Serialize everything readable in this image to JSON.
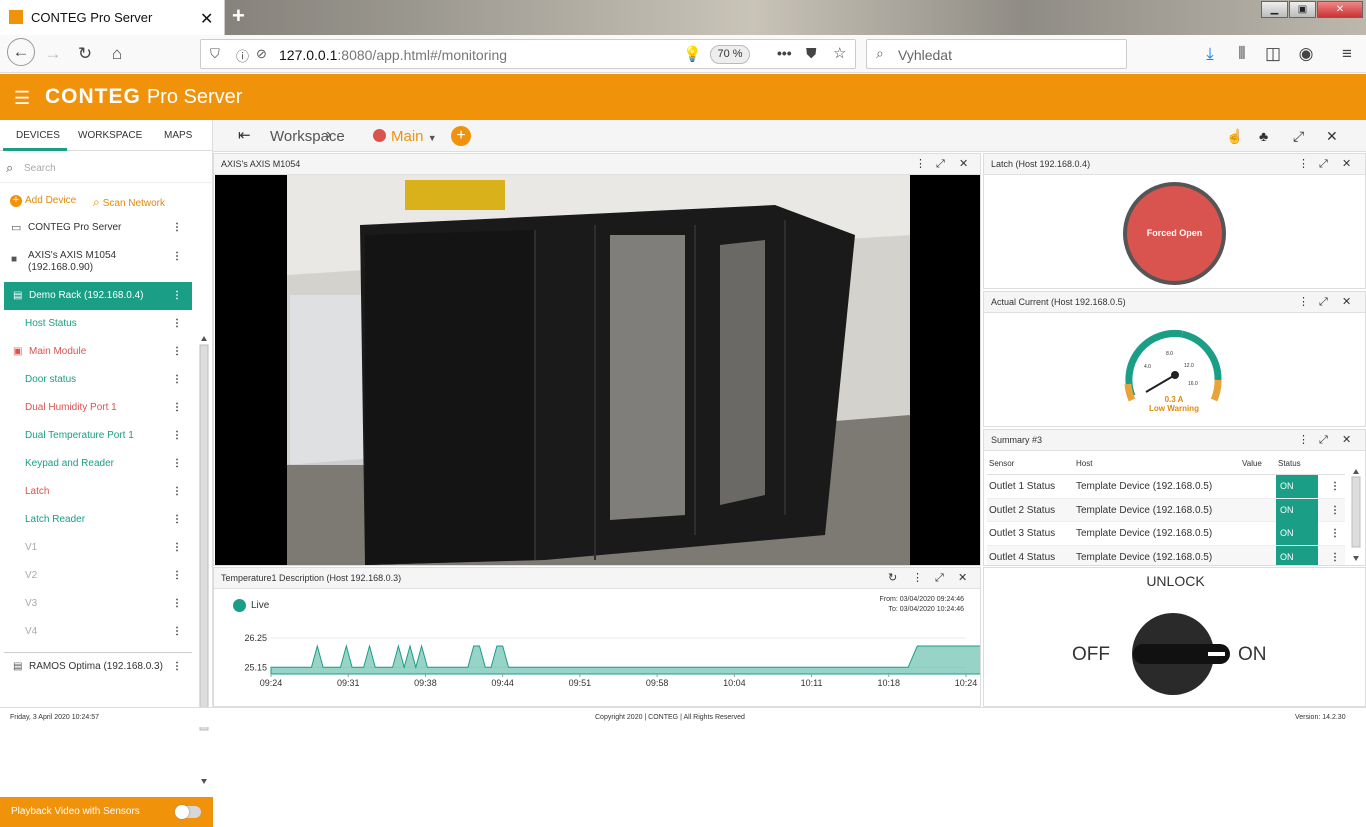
{
  "browser": {
    "tab_title": "CONTEG Pro Server",
    "url_host": "127.0.0.1",
    "url_rest": ":8080/app.html#/monitoring",
    "zoom": "70 %",
    "search_placeholder": "Vyhledat"
  },
  "app": {
    "logo": "CONTEG",
    "logo_sub": "Pro Server",
    "brand_color": "#f0920a",
    "accent_color": "#1a9e86"
  },
  "sidebar": {
    "tabs": [
      "DEVICES",
      "WORKSPACE",
      "MAPS"
    ],
    "search_placeholder": "Search",
    "add_device": "Add Device",
    "scan_network": "Scan Network",
    "items": [
      {
        "label": "CONTEG Pro Server",
        "icon": "monitor-icon"
      },
      {
        "label": "AXIS's AXIS M1054",
        "label2": "(192.168.0.90)",
        "icon": "camera-icon"
      },
      {
        "label": "Demo Rack (192.168.0.4)",
        "icon": "rack-icon"
      },
      {
        "label": "Host Status"
      },
      {
        "label": "Main Module",
        "icon": "module-icon"
      },
      {
        "label": "Door status"
      },
      {
        "label": "Dual Humidity Port 1"
      },
      {
        "label": "Dual Temperature Port 1"
      },
      {
        "label": "Keypad and Reader"
      },
      {
        "label": "Latch"
      },
      {
        "label": "Latch Reader"
      },
      {
        "label": "V1"
      },
      {
        "label": "V2"
      },
      {
        "label": "V3"
      },
      {
        "label": "V4"
      },
      {
        "label": "RAMOS Optima (192.168.0.3)",
        "icon": "rack-icon"
      }
    ],
    "playback": "Playback Video with Sensors"
  },
  "workspace": {
    "label": "Workspace",
    "current": "Main"
  },
  "panels": {
    "camera_title": "AXIS's AXIS M1054",
    "latch_title": "Latch (Host 192.168.0.4)",
    "latch_state": "Forced Open",
    "current_title": "Actual Current (Host 192.168.0.5)",
    "gauge_value": "0.3 A",
    "gauge_status": "Low Warning",
    "summary_title": "Summary #3",
    "summary_headers": [
      "Sensor",
      "Host",
      "Value",
      "Status"
    ],
    "summary_rows": [
      {
        "sensor": "Outlet 1 Status",
        "host": "Template Device (192.168.0.5)",
        "status": "ON"
      },
      {
        "sensor": "Outlet 2 Status",
        "host": "Template Device (192.168.0.5)",
        "status": "ON"
      },
      {
        "sensor": "Outlet 3 Status",
        "host": "Template Device (192.168.0.5)",
        "status": "ON"
      },
      {
        "sensor": "Outlet 4 Status",
        "host": "Template Device (192.168.0.5)",
        "status": "ON"
      }
    ],
    "temp_title": "Temperature1 Description (Host 192.168.0.3)",
    "live": "Live",
    "from": "From: 03/04/2020 09:24:46",
    "to": "To: 03/04/2020 10:24:46",
    "unlock_title": "UNLOCK",
    "switch_off": "OFF",
    "switch_on": "ON"
  },
  "gauge_data": {
    "ticks": [
      "4.0",
      "8.0",
      "12.0",
      "16.0"
    ]
  },
  "chart_data": {
    "type": "area",
    "x_ticks": [
      "09:24",
      "09:31",
      "09:38",
      "09:44",
      "09:51",
      "09:58",
      "10:04",
      "10:11",
      "10:18",
      "10:24"
    ],
    "y_ticks": [
      "26.25",
      "25.15"
    ],
    "ylim": [
      24.9,
      26.4
    ],
    "series_color": "#1a9e86",
    "x_minutes": [
      0,
      3.5,
      4,
      4.5,
      6,
      6.5,
      7,
      8,
      8.5,
      9,
      10.5,
      11,
      11.5,
      12,
      12.5,
      13,
      13.5,
      14,
      17,
      17.5,
      18,
      18.5,
      19,
      19.5,
      20,
      20.5,
      21,
      55,
      55.8,
      62
    ],
    "values": [
      25.15,
      25.15,
      25.95,
      25.15,
      25.15,
      25.95,
      25.15,
      25.15,
      25.95,
      25.15,
      25.15,
      25.95,
      25.15,
      25.95,
      25.15,
      25.95,
      25.15,
      25.15,
      25.15,
      25.95,
      25.95,
      25.15,
      25.15,
      25.95,
      25.95,
      25.15,
      25.15,
      25.15,
      25.95,
      25.95
    ]
  },
  "footer": {
    "date": "Friday, 3 April 2020 10:24:57",
    "copyright": "Copyright 2020 | CONTEG | All Rights Reserved",
    "version": "Version: 14.2.30"
  }
}
